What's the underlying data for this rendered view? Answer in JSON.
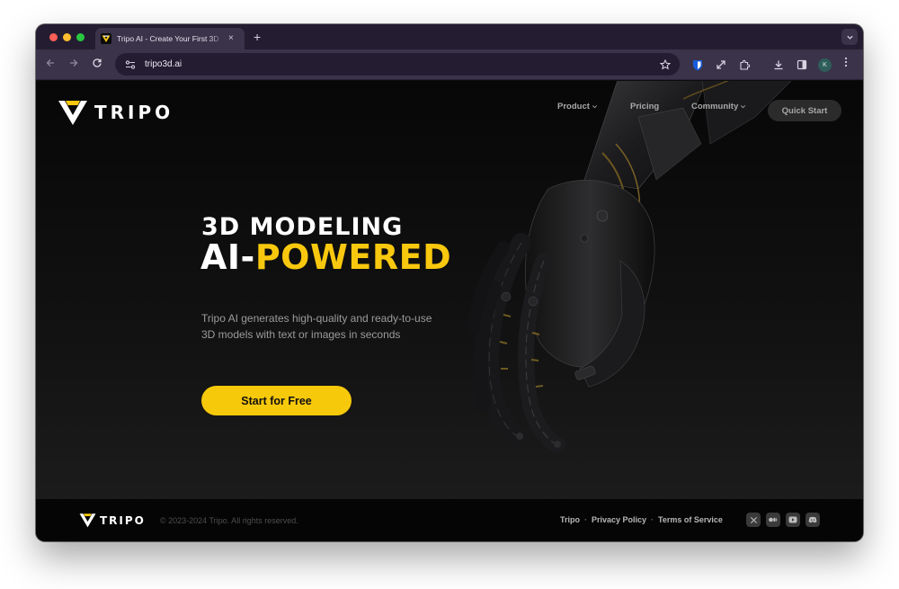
{
  "browser": {
    "tab_title": "Tripo AI - Create Your First 3D",
    "tab_close": "×",
    "new_tab": "+",
    "url": "tripo3d.ai",
    "avatar_initial": "K",
    "icons": [
      "back-arrow-icon",
      "forward-arrow-icon",
      "reload-icon",
      "site-settings-icon",
      "bookmark-star-icon",
      "bitwarden-icon",
      "resize-icon",
      "extensions-icon",
      "download-icon",
      "side-panel-icon",
      "more-menu-icon"
    ]
  },
  "nav": {
    "logo_text": "TRIPO",
    "product": "Product",
    "pricing": "Pricing",
    "community": "Community",
    "quick_start": "Quick Start"
  },
  "hero": {
    "line1": "3D MODELING",
    "line2_white": "AI-",
    "line2_yellow": "POWERED",
    "subtitle_1": "Tripo AI generates high-quality and ready-to-use",
    "subtitle_2": "3D models with text or images in seconds",
    "cta": "Start for Free"
  },
  "footer": {
    "logo_text": "TRIPO",
    "copyright": "© 2023-2024 Tripo. All rights reserved.",
    "links": [
      "Tripo",
      "Privacy Policy",
      "Terms of Service"
    ],
    "separator": "·",
    "socials": [
      "x-icon",
      "medium-icon",
      "youtube-icon",
      "discord-icon"
    ]
  },
  "colors": {
    "accent_yellow": "#f8c80e",
    "browser_frame": "#241d31",
    "toolbar": "#3b3349",
    "page_bg": "#0c0c0e"
  }
}
